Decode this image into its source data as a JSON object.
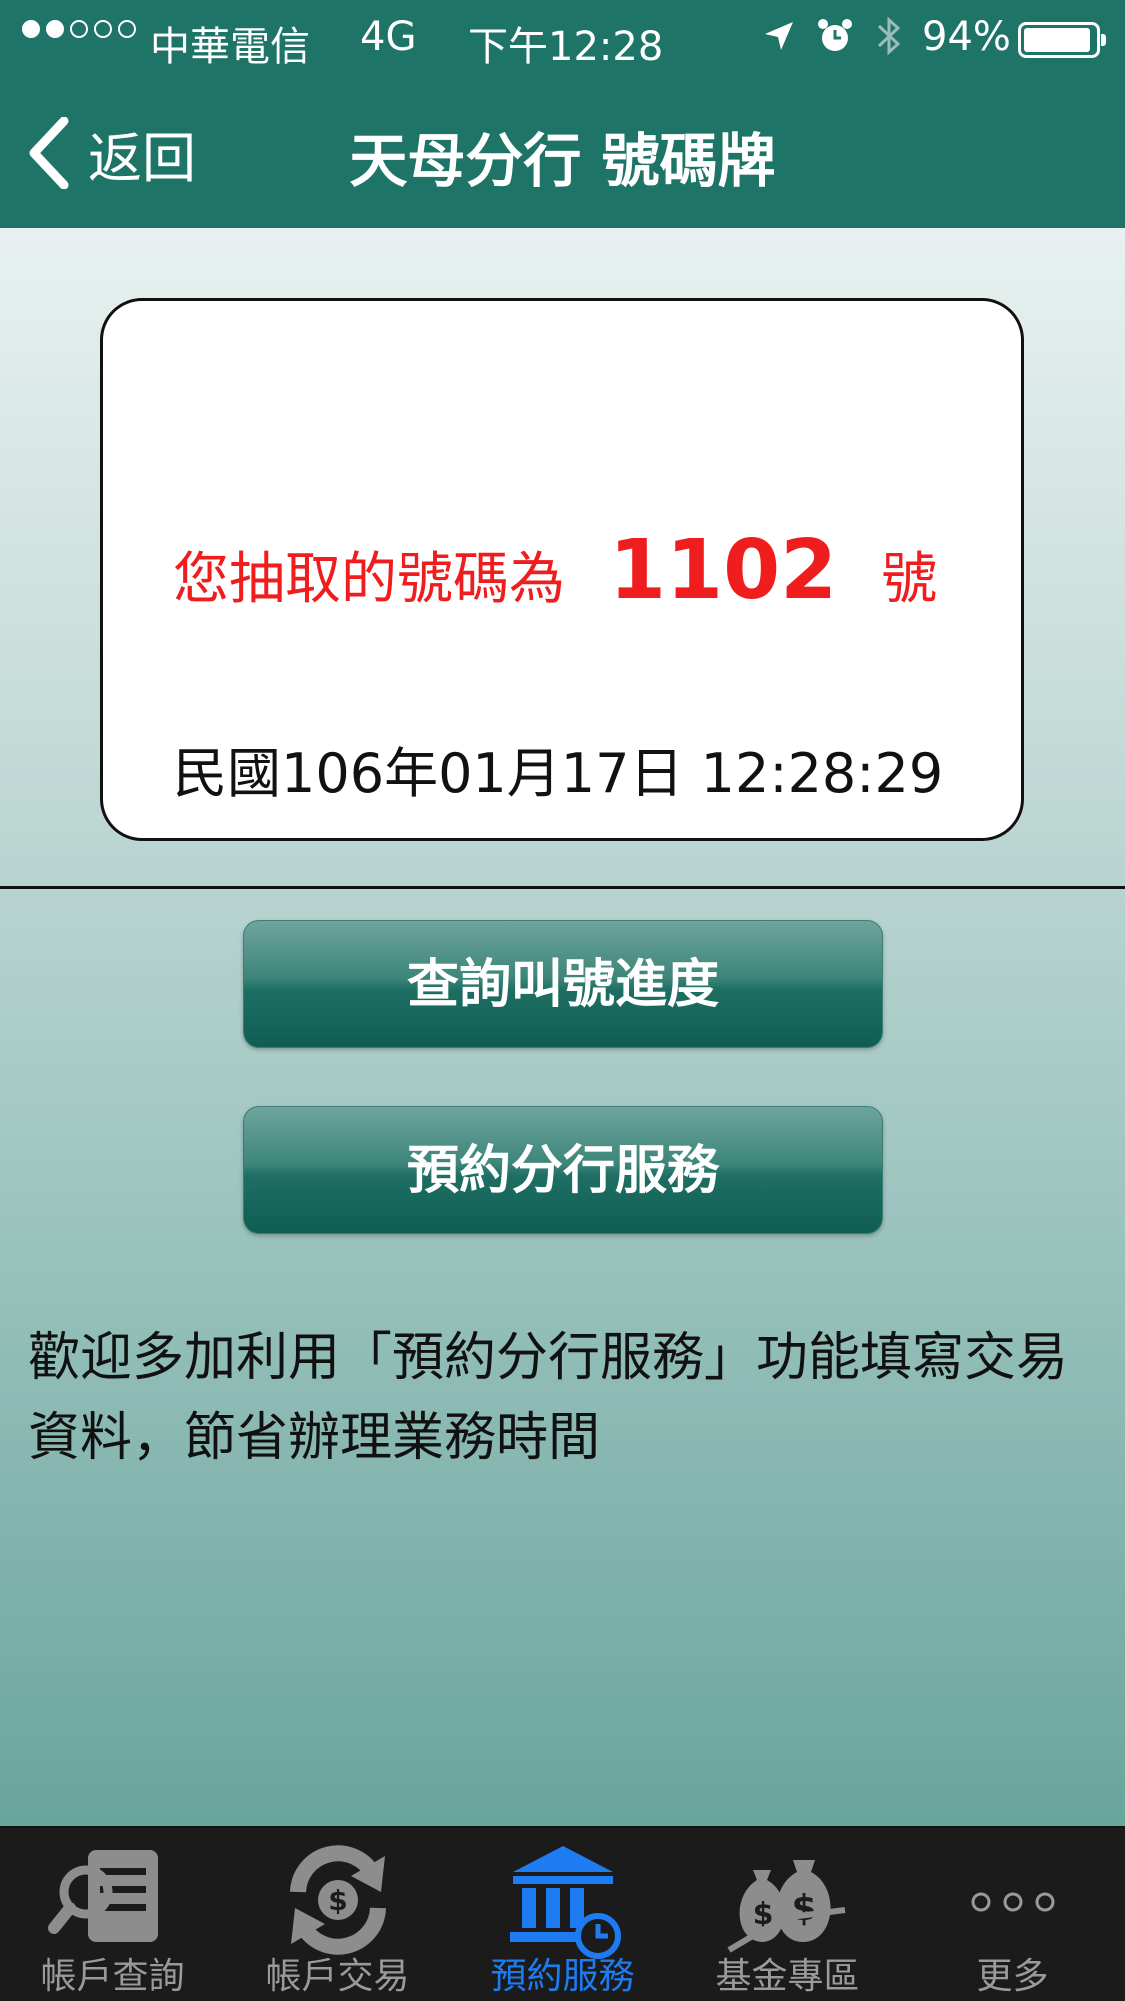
{
  "status_bar": {
    "carrier": "中華電信",
    "network": "4G",
    "time": "下午12:28",
    "battery_percent": "94%",
    "battery_level": 0.94,
    "signal_bars_filled": 2,
    "signal_bars_total": 5,
    "icons": [
      "location-arrow-icon",
      "alarm-icon",
      "bluetooth-icon"
    ]
  },
  "nav": {
    "back_label": "返回",
    "title": "天母分行 號碼牌"
  },
  "ticket": {
    "prefix": "您抽取的號碼為",
    "number": "1102",
    "unit": "號",
    "datetime": "民國106年01月17日 12:28:29"
  },
  "buttons": {
    "check_progress": "查詢叫號進度",
    "reserve_branch": "預約分行服務"
  },
  "info_text": "歡迎多加利用「預約分行服務」功能填寫交易資料，節省辦理業務時間",
  "tab_bar": {
    "items": [
      {
        "label": "帳戶查詢",
        "icon": "scroll-search-icon",
        "active": false
      },
      {
        "label": "帳戶交易",
        "icon": "exchange-arrows-icon",
        "active": false
      },
      {
        "label": "預約服務",
        "icon": "bank-clock-icon",
        "active": true
      },
      {
        "label": "基金專區",
        "icon": "money-bags-icon",
        "active": false
      },
      {
        "label": "更多",
        "icon": "more-dots-icon",
        "active": false
      }
    ]
  },
  "colors": {
    "header": "#1f7468",
    "ticket_text": "#ef1d1d",
    "tab_active": "#1d7cf2",
    "tab_inactive": "#9a9a9a"
  }
}
